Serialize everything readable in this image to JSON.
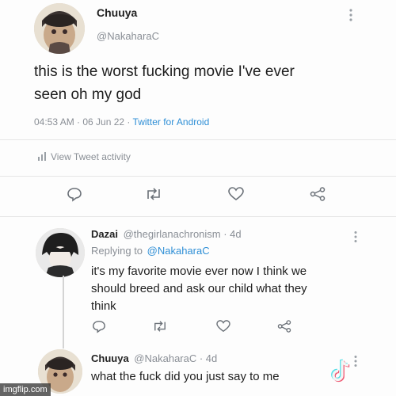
{
  "main_tweet": {
    "display_name": "Chuuya",
    "handle": "@NakaharaC",
    "text_line1": "this is the worst fucking movie I've ever",
    "text_line2": "seen oh my god",
    "time": "04:53 AM",
    "date_sep": " · ",
    "date": "06 Jun 22",
    "source_sep": " · ",
    "source": "Twitter for Android",
    "activity_label": "View Tweet activity"
  },
  "reply_1": {
    "display_name": "Dazai",
    "handle": "@thegirlanachronism · 4d",
    "replying_prefix": "Replying to",
    "replying_to": "@NakaharaC",
    "text_line1": "it's my favorite movie ever now I think we",
    "text_line2": "should breed and ask our child what they",
    "text_line3": "think"
  },
  "reply_2": {
    "display_name": "Chuuya",
    "handle": "@NakaharaC · 4d",
    "text_line1": "what the fuck did you just say to me"
  },
  "watermark": "imgflip.com",
  "icons": [
    "reply-icon",
    "retweet-icon",
    "like-icon",
    "share-icon",
    "more-icon",
    "activity-icon",
    "tiktok-icon"
  ],
  "colors": {
    "link": "#2f8fd6",
    "meta": "#8a8f96",
    "text": "#1d1d1d"
  }
}
